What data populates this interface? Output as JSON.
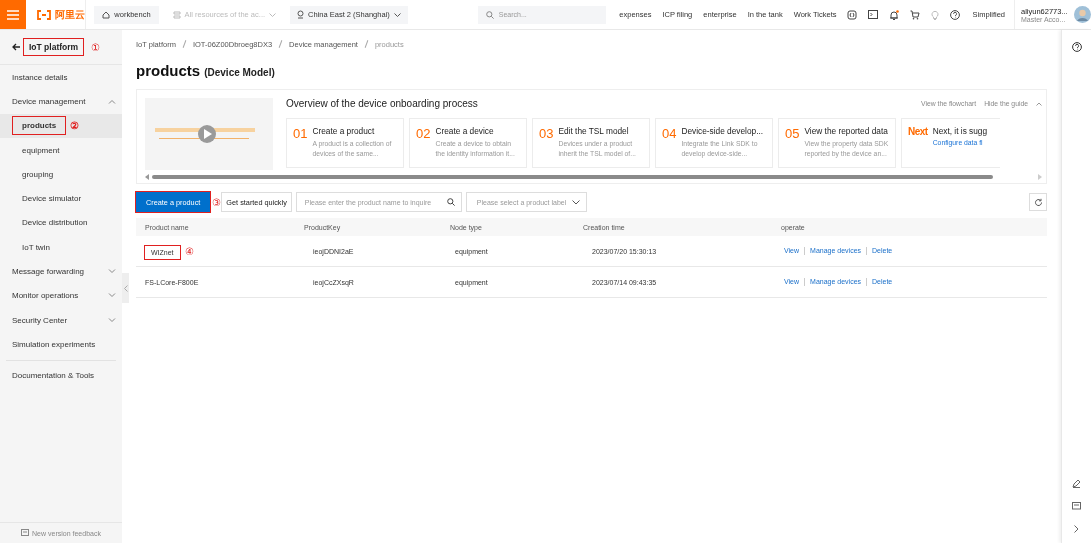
{
  "topbar": {
    "logo": "阿里云",
    "workbench": "workbench",
    "resource_select": {
      "value": "All resources of the ac...",
      "disabled": true
    },
    "region": "China East 2 (Shanghai)",
    "search": {
      "placeholder": "Search..."
    },
    "links": [
      "expenses",
      "ICP filing",
      "enterprise",
      "In the tank",
      "Work Tickets"
    ],
    "notification_dot": true,
    "language": "Simplified",
    "user": {
      "name": "aliyun62773...",
      "role": "Master Acco..."
    }
  },
  "sidebar": {
    "back": {
      "label": "IoT platform",
      "annotation": "①"
    },
    "items": [
      {
        "label": "Instance details",
        "kind": "link"
      },
      {
        "label": "Device management",
        "kind": "group",
        "expanded": true,
        "children": [
          {
            "label": "products",
            "selected": true,
            "annotation": "②"
          },
          {
            "label": "equipment",
            "selected": false
          },
          {
            "label": "grouping",
            "selected": false
          },
          {
            "label": "Device simulator",
            "selected": false
          },
          {
            "label": "Device distribution",
            "selected": false
          },
          {
            "label": "IoT twin",
            "selected": false
          }
        ]
      },
      {
        "label": "Message forwarding",
        "kind": "group",
        "expanded": false
      },
      {
        "label": "Monitor operations",
        "kind": "group",
        "expanded": false
      },
      {
        "label": "Security Center",
        "kind": "group",
        "expanded": false
      },
      {
        "label": "Simulation experiments",
        "kind": "link"
      },
      {
        "label": "Documentation & Tools",
        "kind": "link"
      }
    ],
    "feedback": "New version feedback"
  },
  "breadcrumb": [
    "IoT platform",
    "IOT-06Z00Dbroeg8DX3",
    "Device management",
    "products"
  ],
  "page_title": "products",
  "page_subtitle": "(Device Model)",
  "guide": {
    "video": {
      "kind": "picture"
    },
    "title": "Overview of the device onboarding process",
    "actions": [
      "View the flowchart",
      "Hide the guide"
    ],
    "steps": [
      {
        "number": "01",
        "title": "Create a product",
        "description": "A product is a collection of devices of the same..."
      },
      {
        "number": "02",
        "title": "Create a device",
        "description": "Create a device to obtain the identity information it..."
      },
      {
        "number": "03",
        "title": "Edit the TSL model",
        "description": "Devices under a product inherit the TSL model of..."
      },
      {
        "number": "04",
        "title": "Device-side develop...",
        "description": "Integrate the Link SDK to develop device-side..."
      },
      {
        "number": "05",
        "title": "View the reported data",
        "description": "View the property data SDK reported by the device an..."
      },
      {
        "number": "Next",
        "title": "Next, it is sugg",
        "link": "Configure data fl"
      }
    ]
  },
  "toolbar": {
    "create_button": {
      "label": "Create a product",
      "annotation": "③"
    },
    "quick_button": "Get started quickly",
    "search": {
      "placeholder": "Please enter the product name to inquire"
    },
    "label_select": {
      "placeholder": "Please select a product label"
    }
  },
  "table": {
    "columns": [
      "Product name",
      "ProductKey",
      "Node type",
      "Creation time",
      "operate"
    ],
    "rows": [
      {
        "name": "WIZnet",
        "annotation": "④",
        "key": "ieojDDNI2aE",
        "node_type": "equipment",
        "created": "2023/07/20 15:30:13",
        "actions": [
          "View",
          "Manage devices",
          "Delete"
        ]
      },
      {
        "name": "FS-LCore-F800E",
        "key": "ieojCcZXsqR",
        "node_type": "equipment",
        "created": "2023/07/14 09:43:35",
        "actions": [
          "View",
          "Manage devices",
          "Delete"
        ]
      }
    ]
  }
}
